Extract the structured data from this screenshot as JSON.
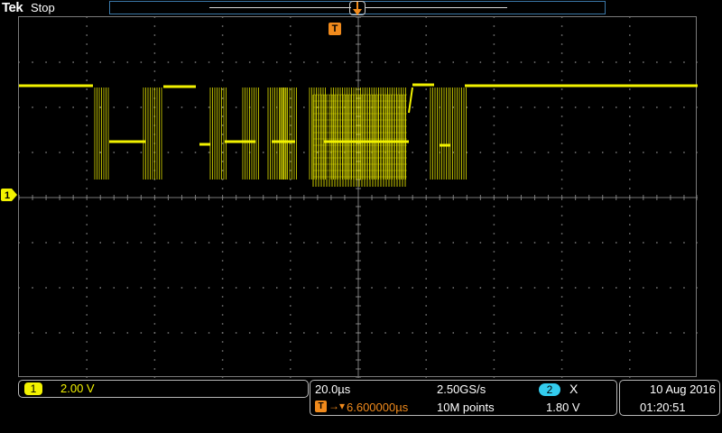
{
  "header": {
    "brand": "Tek",
    "run_state": "Stop"
  },
  "trigger": {
    "marker_label": "T"
  },
  "channel1": {
    "badge": "1",
    "marker_label": "1",
    "scale": "2.00 V",
    "trace_color": "#f2f200"
  },
  "horizontal": {
    "timebase": "20.0µs",
    "sample_rate": "2.50GS/s",
    "trigger_delay_icon": "T",
    "trigger_delay_arrow": "→▾",
    "trigger_delay": "6.600000µs",
    "record_length": "10M points"
  },
  "trigger_settings": {
    "source_badge": "2",
    "slope_icon": "X",
    "level": "1.80 V",
    "source_color": "#33ccee"
  },
  "datetime": {
    "date": "10 Aug 2016",
    "time": "01:20:51"
  },
  "colors": {
    "trigger_accent": "#f08a1c",
    "graticule": "#7a7a7a",
    "overview_border": "#3b78a8"
  }
}
